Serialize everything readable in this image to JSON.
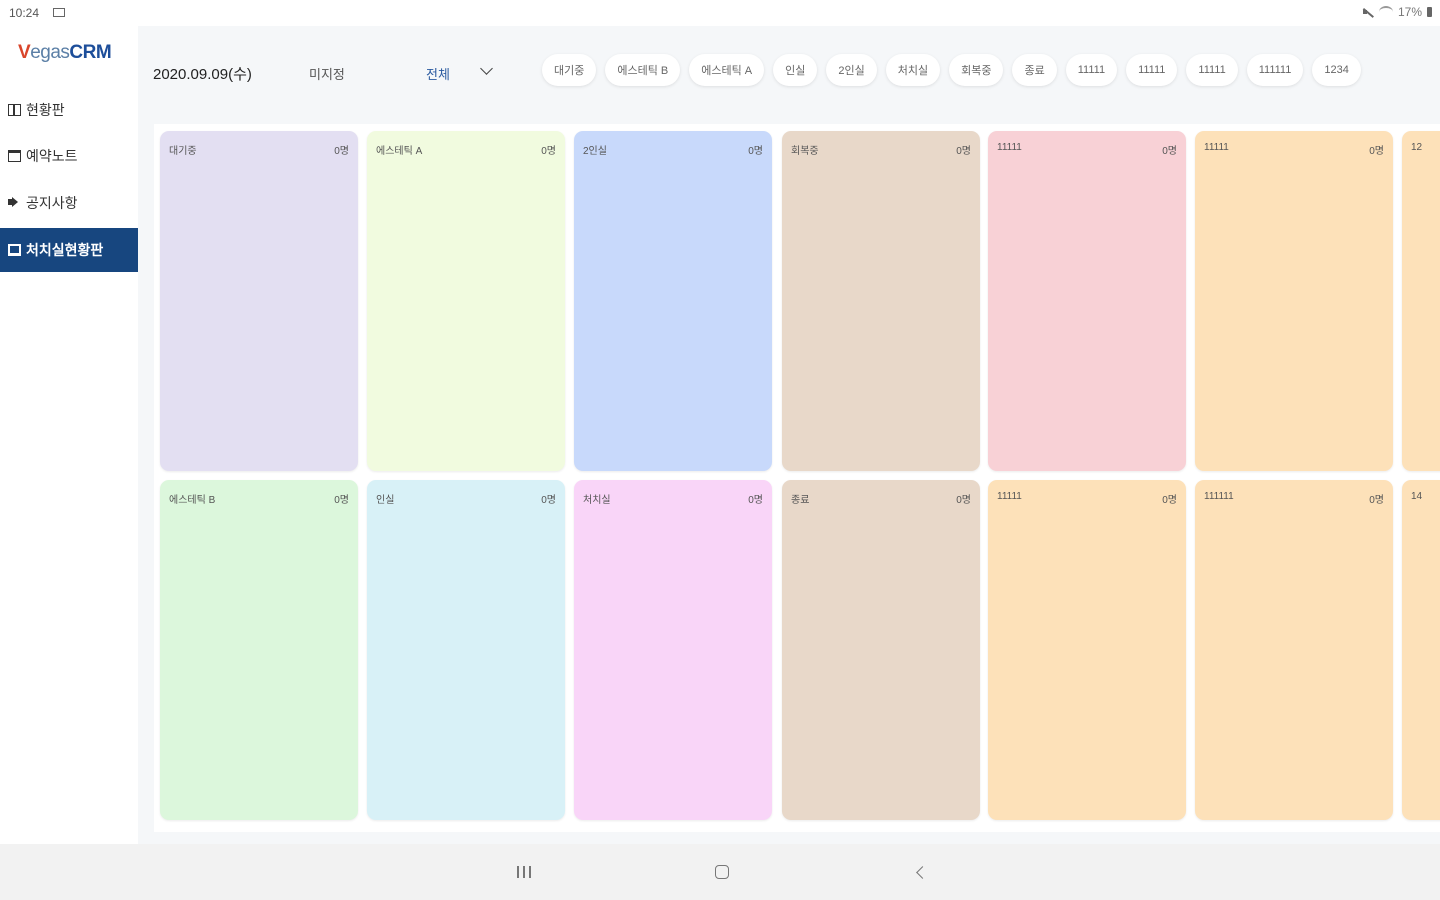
{
  "status_bar": {
    "time": "10:24",
    "battery": "17%"
  },
  "sidebar": {
    "logo": {
      "v": "V",
      "egas": "egas",
      "crm": "CRM"
    },
    "items": [
      {
        "label": "현황판",
        "icon": "board-icon",
        "active": false
      },
      {
        "label": "예약노트",
        "icon": "calendar-icon",
        "active": false
      },
      {
        "label": "공지사항",
        "icon": "speaker-icon",
        "active": false
      },
      {
        "label": "처치실현황판",
        "icon": "monitor-icon",
        "active": true
      }
    ]
  },
  "header": {
    "date": "2020.09.09(수)",
    "unassigned": "미지정",
    "filter": "전체",
    "chips": [
      "대기중",
      "에스테틱 B",
      "에스테틱 A",
      "인실",
      "2인실",
      "처치실",
      "회복중",
      "종료",
      "11111",
      "11111",
      "11111",
      "111111",
      "1234"
    ]
  },
  "cards": [
    {
      "name": "대기중",
      "count": "0명",
      "color": "#e3dff2"
    },
    {
      "name": "에스테틱 A",
      "count": "0명",
      "color": "#f1fbdf"
    },
    {
      "name": "2인실",
      "count": "0명",
      "color": "#c8d9fb"
    },
    {
      "name": "회복중",
      "count": "0명",
      "color": "#e8d8c9"
    },
    {
      "name": "11111",
      "count": "0명",
      "color": "#f8d1d6"
    },
    {
      "name": "11111",
      "count": "0명",
      "color": "#fde1b9"
    },
    {
      "name": "12",
      "count": "",
      "color": "#fde1b9"
    },
    {
      "name": "에스테틱 B",
      "count": "0명",
      "color": "#dcf7dc"
    },
    {
      "name": "인실",
      "count": "0명",
      "color": "#d8f1f7"
    },
    {
      "name": "처치실",
      "count": "0명",
      "color": "#f9d5f8"
    },
    {
      "name": "종료",
      "count": "0명",
      "color": "#e8d8c9"
    },
    {
      "name": "11111",
      "count": "0명",
      "color": "#fde1b9"
    },
    {
      "name": "111111",
      "count": "0명",
      "color": "#fde1b9"
    },
    {
      "name": "14",
      "count": "",
      "color": "#fde1b9"
    }
  ]
}
